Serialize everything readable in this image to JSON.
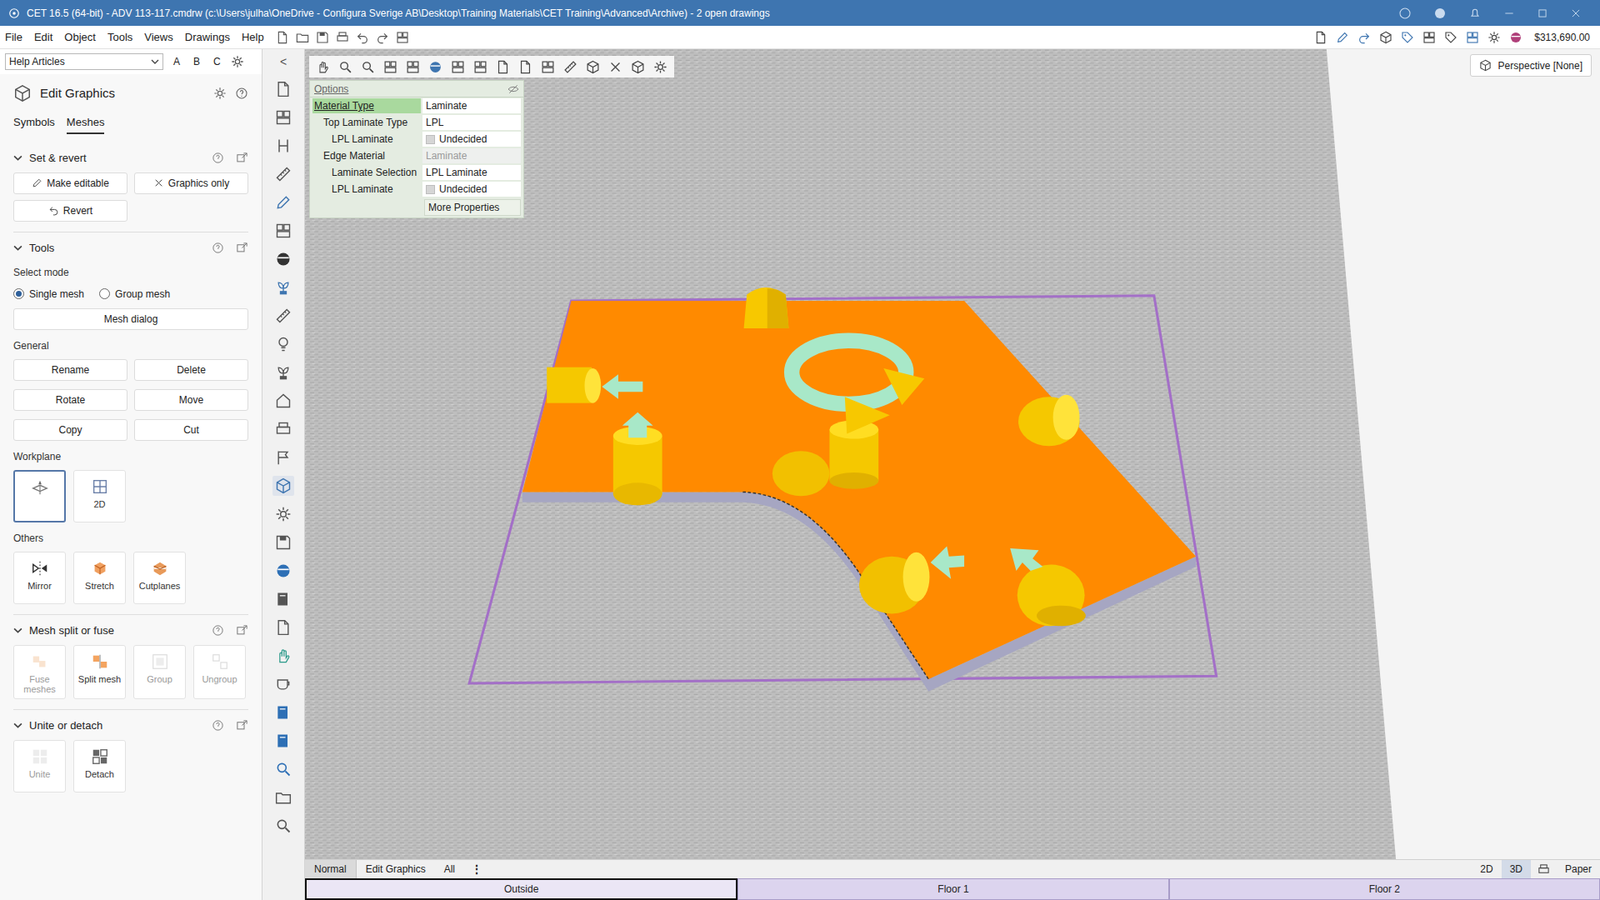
{
  "window": {
    "title": "CET 16.5 (64-bit) - ADV 113-117.cmdrw (c:\\Users\\julha\\OneDrive - Configura Sverige AB\\Desktop\\Training Materials\\CET Training\\Advanced\\Archive) - 2  open drawings"
  },
  "menu": [
    "File",
    "Edit",
    "Object",
    "Tools",
    "Views",
    "Drawings",
    "Help"
  ],
  "price": "$313,690.00",
  "help_dropdown": {
    "value": "Help Articles"
  },
  "quick_buttons": [
    "A",
    "B",
    "C"
  ],
  "collapse": "<",
  "panel": {
    "title": "Edit Graphics",
    "tabs": [
      {
        "label": "Symbols",
        "selected": false
      },
      {
        "label": "Meshes",
        "selected": true
      }
    ],
    "sections": [
      {
        "title": "Set & revert",
        "expanded": true,
        "blocks": [
          {
            "kind": "buttons",
            "items": [
              {
                "label": "Make editable"
              },
              {
                "label": "Graphics only"
              }
            ]
          },
          {
            "kind": "buttons",
            "items": [
              {
                "label": "Revert"
              }
            ]
          }
        ]
      },
      {
        "title": "Tools",
        "expanded": true,
        "blocks": [
          {
            "kind": "label",
            "text": "Select mode"
          },
          {
            "kind": "radios",
            "items": [
              {
                "label": "Single mesh",
                "selected": true
              },
              {
                "label": "Group mesh",
                "selected": false
              }
            ]
          },
          {
            "kind": "wide",
            "items": [
              {
                "label": "Mesh dialog"
              }
            ]
          },
          {
            "kind": "label",
            "text": "General"
          },
          {
            "kind": "buttons",
            "items": [
              {
                "label": "Rename"
              },
              {
                "label": "Delete"
              },
              {
                "label": "Rotate"
              },
              {
                "label": "Move"
              },
              {
                "label": "Copy"
              },
              {
                "label": "Cut"
              }
            ]
          },
          {
            "kind": "label",
            "text": "Workplane"
          },
          {
            "kind": "tiles",
            "items": [
              {
                "selected": true
              },
              {
                "label": "2D",
                "selected": false
              }
            ]
          },
          {
            "kind": "label",
            "text": "Others"
          },
          {
            "kind": "tiles",
            "items": [
              {
                "label": "Mirror"
              },
              {
                "label": "Stretch"
              },
              {
                "label": "Cutplanes"
              }
            ]
          }
        ]
      },
      {
        "title": "Mesh split or fuse",
        "expanded": true,
        "blocks": [
          {
            "kind": "tiles",
            "items": [
              {
                "label": "Fuse meshes",
                "disabled": true
              },
              {
                "label": "Split mesh",
                "disabled": false
              },
              {
                "label": "Group",
                "disabled": true
              },
              {
                "label": "Ungroup",
                "disabled": true
              }
            ]
          }
        ]
      },
      {
        "title": "Unite or detach",
        "expanded": true,
        "blocks": [
          {
            "kind": "tiles",
            "items": [
              {
                "label": "Unite",
                "disabled": true
              },
              {
                "label": "Detach",
                "disabled": false
              }
            ]
          }
        ]
      }
    ]
  },
  "options": {
    "title": "Options",
    "rows": [
      {
        "label": "Material Type",
        "value": "Laminate",
        "kind": "text",
        "indent": 0,
        "selected": true,
        "disabled": false
      },
      {
        "label": "Top Laminate Type",
        "value": "LPL",
        "kind": "text",
        "indent": 1,
        "selected": false,
        "disabled": false
      },
      {
        "label": "LPL Laminate",
        "value": "Undecided",
        "kind": "check",
        "indent": 2,
        "selected": false,
        "disabled": false
      },
      {
        "label": "Edge Material",
        "value": "Laminate",
        "kind": "text",
        "indent": 1,
        "selected": false,
        "disabled": true
      },
      {
        "label": "Laminate Selection",
        "value": "LPL Laminate",
        "kind": "text",
        "indent": 2,
        "selected": false,
        "disabled": false
      },
      {
        "label": "LPL Laminate",
        "value": "Undecided",
        "kind": "check",
        "indent": 2,
        "selected": false,
        "disabled": false
      }
    ],
    "more": "More Properties"
  },
  "perspective": "Perspective [None]",
  "bottom_tabs": [
    {
      "label": "Normal",
      "selected": true
    },
    {
      "label": "Edit Graphics",
      "selected": false
    },
    {
      "label": "All",
      "selected": false
    }
  ],
  "bottom_more": "⋮",
  "view_buttons": [
    {
      "label": "2D",
      "selected": false
    },
    {
      "label": "3D",
      "selected": true
    }
  ],
  "paper": "Paper",
  "floors": [
    {
      "label": "Outside",
      "selected": true
    },
    {
      "label": "Floor 1",
      "selected": false
    },
    {
      "label": "Floor 2",
      "selected": false
    }
  ]
}
